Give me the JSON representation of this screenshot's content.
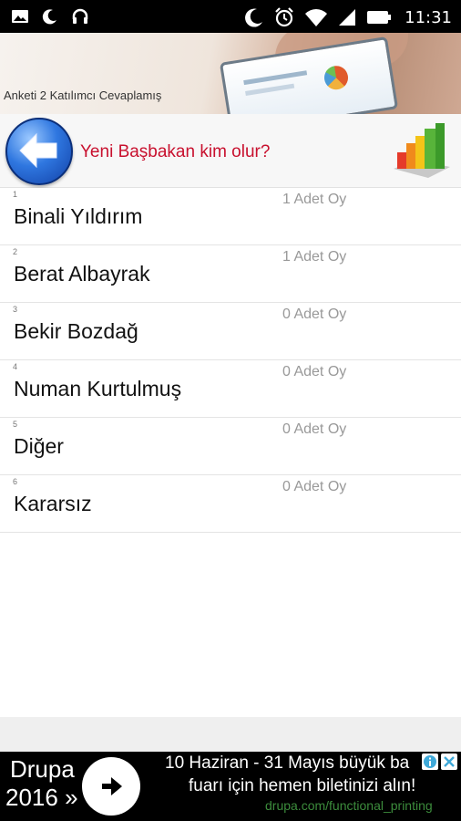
{
  "status_bar": {
    "time": "11:31",
    "icons_left": [
      "image-icon",
      "moon-icon",
      "headset-icon"
    ],
    "icons_right": [
      "moon-icon",
      "alarm-icon",
      "wifi-icon",
      "signal-icon",
      "battery-icon"
    ]
  },
  "banner": {
    "text": "Anketi  2 Katılımcı Cevaplamış"
  },
  "header": {
    "question": "Yeni Başbakan kim olur?",
    "back_icon": "back-arrow-icon",
    "chart_icon": "bar-chart-icon"
  },
  "options": [
    {
      "index": "1",
      "name": "Binali Yıldırım",
      "votes": "1 Adet Oy"
    },
    {
      "index": "2",
      "name": "Berat Albayrak",
      "votes": "1 Adet Oy"
    },
    {
      "index": "3",
      "name": "Bekir Bozdağ",
      "votes": "0 Adet Oy"
    },
    {
      "index": "4",
      "name": "Numan Kurtulmuş",
      "votes": "0 Adet Oy"
    },
    {
      "index": "5",
      "name": "Diğer",
      "votes": "0 Adet Oy"
    },
    {
      "index": "6",
      "name": "Kararsız",
      "votes": "0 Adet Oy"
    }
  ],
  "ad": {
    "brand_line1": "Drupa",
    "brand_line2": "2016 »",
    "line1": "10 Haziran - 31 Mayıs büyük ba",
    "line2": "fuarı için hemen biletinizi alın!",
    "url": "drupa.com/functional_printing"
  }
}
